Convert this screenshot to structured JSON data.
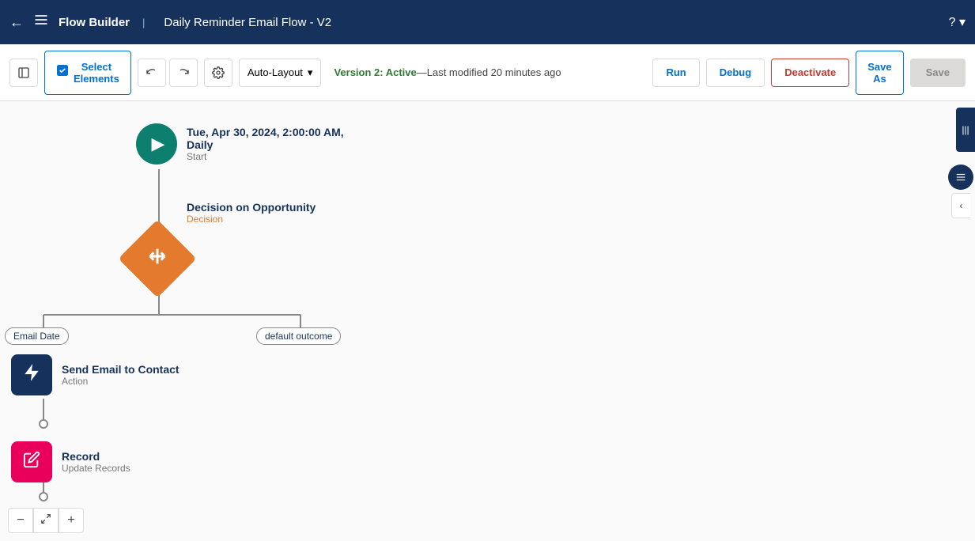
{
  "navbar": {
    "back_label": "←",
    "app_icon": "≡",
    "app_title": "Flow Builder",
    "flow_name": "Daily Reminder Email Flow - V2",
    "help_icon": "?"
  },
  "toolbar": {
    "toggle_icon": "☰",
    "select_label_top": "Select",
    "select_label_bottom": "Elements",
    "undo_icon": "↩",
    "redo_icon": "↪",
    "settings_icon": "⚙",
    "auto_layout_label": "Auto-Layout",
    "auto_layout_chevron": "▾",
    "version_text": "Version 2: Active—Last modified 20 minutes ago",
    "run_label": "Run",
    "debug_label": "Debug",
    "deactivate_label": "Deactivate",
    "save_as_label_top": "Save",
    "save_as_label_bottom": "As",
    "save_label": "Save"
  },
  "flow": {
    "start_node": {
      "date_text": "Tue, Apr 30, 2024, 2:00:00 AM,",
      "frequency_text": "Daily",
      "type_text": "Start"
    },
    "decision_node": {
      "title": "Decision on Opportunity",
      "type": "Decision"
    },
    "branch_left": {
      "label": "Email Date"
    },
    "branch_right": {
      "label": "default outcome"
    },
    "action_node": {
      "title": "Send Email to Contact",
      "type": "Action"
    },
    "record_node": {
      "title": "Record",
      "type": "Update Records"
    }
  },
  "zoom_controls": {
    "minus": "−",
    "expand": "⤢",
    "plus": "+"
  },
  "colors": {
    "navbar": "#16325c",
    "start_node": "#0d7f6e",
    "decision": "#e47a2e",
    "action": "#16325c",
    "record": "#e8005a",
    "deactivate_text": "#c23934",
    "active_text": "#2e7d32"
  }
}
